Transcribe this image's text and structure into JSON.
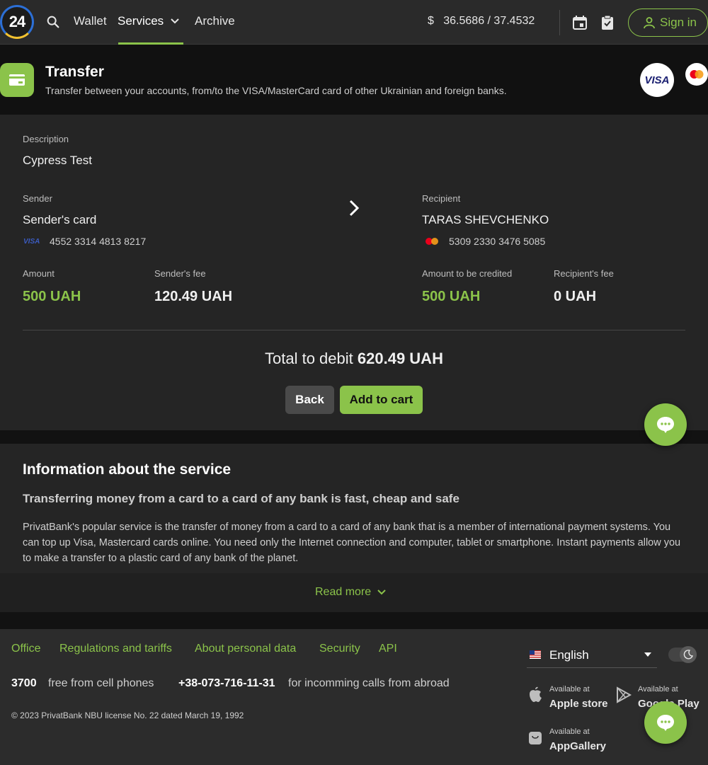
{
  "nav": {
    "logo_text": "24",
    "wallet": "Wallet",
    "services": "Services",
    "archive": "Archive",
    "rate_symbol": "$",
    "rate": "36.5686 / 37.4532",
    "signin": "Sign in"
  },
  "header": {
    "title": "Transfer",
    "subtitle": "Transfer between your accounts, from/to the VISA/MasterCard card of other Ukrainian and foreign banks.",
    "visa_badge": "VISA"
  },
  "card": {
    "description_label": "Description",
    "description_value": "Cypress Test",
    "sender_label": "Sender",
    "sender_value": "Sender's card",
    "sender_card_brand": "VISA",
    "sender_card_number": "4552 3314 4813 8217",
    "recipient_label": "Recipient",
    "recipient_value": "TARAS SHEVCHENKO",
    "recipient_card_number": "5309 2330 3476 5085",
    "amount_label": "Amount",
    "amount_value": "500 UAH",
    "sender_fee_label": "Sender's fee",
    "sender_fee_value": "120.49 UAH",
    "credited_label": "Amount to be credited",
    "credited_value": "500 UAH",
    "recipient_fee_label": "Recipient's fee",
    "recipient_fee_value": "0 UAH",
    "total_label": "Total to debit",
    "total_value": "620.49 UAH",
    "back": "Back",
    "add_to_cart": "Add to cart"
  },
  "info": {
    "title": "Information about the service",
    "subtitle": "Transferring money from a card to a card of any bank is fast, cheap and safe",
    "text": "PrivatBank's popular service is the transfer of money from a card to a card of any bank that is a member of international payment systems. You can top up Visa, Mastercard cards online. You need only the Internet connection and computer, tablet or smartphone. Instant payments allow you to make a transfer to a plastic card of any bank of the planet.",
    "read_more": "Read more"
  },
  "footer": {
    "links": [
      "Office",
      "Regulations and tariffs",
      "About personal data",
      "Security",
      "API"
    ],
    "phone1": "3700",
    "phone1_text": "free from cell phones",
    "phone2": "+38-073-716-11-31",
    "phone2_text": "for incomming calls from abroad",
    "copyright": "© 2023 PrivatBank NBU license No. 22 dated March 19, 1992",
    "language": "English",
    "available_at": "Available at",
    "apple": "Apple store",
    "google": "Google Play",
    "appgallery": "AppGallery"
  },
  "colors": {
    "accent": "#8bc34a",
    "background": "#121212",
    "card": "#252525"
  }
}
